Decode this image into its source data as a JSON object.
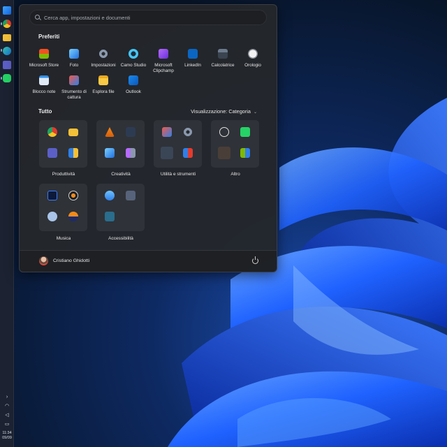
{
  "search": {
    "placeholder": "Cerca app, impostazioni e documenti"
  },
  "pinned": {
    "title": "Preferiti",
    "items": [
      {
        "label": "Microsoft Store",
        "icon": "microsoft-store-icon"
      },
      {
        "label": "Foto",
        "icon": "photos-icon"
      },
      {
        "label": "Impostazioni",
        "icon": "settings-gear-icon"
      },
      {
        "label": "Camo Studio",
        "icon": "camo-icon"
      },
      {
        "label": "Microsoft Clipchamp",
        "icon": "clipchamp-icon"
      },
      {
        "label": "LinkedIn",
        "icon": "linkedin-icon"
      },
      {
        "label": "Calcolatrice",
        "icon": "calculator-icon"
      },
      {
        "label": "Orologio",
        "icon": "clock-icon"
      },
      {
        "label": "Blocco note",
        "icon": "notepad-icon"
      },
      {
        "label": "Strumento di cattura",
        "icon": "snipping-tool-icon"
      },
      {
        "label": "Esplora file",
        "icon": "file-explorer-icon"
      },
      {
        "label": "Outlook",
        "icon": "outlook-icon"
      }
    ]
  },
  "all": {
    "title": "Tutto",
    "view_label": "Visualizzazione: Categoria",
    "categories": [
      {
        "label": "Produttività"
      },
      {
        "label": "Creatività"
      },
      {
        "label": "Utilità e strumenti"
      },
      {
        "label": "Altro"
      },
      {
        "label": "Musica"
      },
      {
        "label": "Accessibilità"
      }
    ]
  },
  "user": {
    "name": "Cristiano Ghidotti"
  },
  "taskbar": {
    "time": "11:34",
    "date": "09/09"
  },
  "colors": {
    "accent": "#0a5cff",
    "menu_bg": "#24262b"
  }
}
